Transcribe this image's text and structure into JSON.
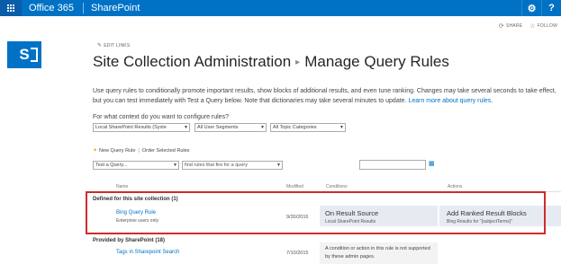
{
  "suite": {
    "brand": "Office 365",
    "product": "SharePoint",
    "settings_icon": "gear-icon",
    "help_icon": "question-icon",
    "accent": "#0072c6"
  },
  "page_actions": {
    "share": "SHARE",
    "follow": "FOLLOW"
  },
  "edit_links": "EDIT LINKS",
  "title": {
    "part1": "Site Collection Administration",
    "part2": "Manage Query Rules"
  },
  "description": {
    "text": "Use query rules to conditionally promote important results, show blocks of additional results, and even tune ranking. Changes may take several seconds to take effect, but you can test immediately with Test a Query below. Note that dictionaries may take several minutes to update.",
    "link": "Learn more about query rules."
  },
  "context": {
    "label": "For what context do you want to configure rules?",
    "source": "Local SharePoint Results (Syste",
    "segments": "All User Segments",
    "topics": "All Topic Categories"
  },
  "commands": {
    "new_rule": "New Query Rule",
    "divider": "|",
    "order": "Order Selected Rules"
  },
  "test": {
    "query": "Test a Query...",
    "find": "find rules that fire for a query"
  },
  "table": {
    "headers": {
      "name": "Name",
      "modified": "Modified",
      "conditions": "Conditions",
      "actions": "Actions"
    },
    "group1": {
      "title": "Defined for this site collection (1)",
      "rows": [
        {
          "name": "Bing Query Rule",
          "sub": "Enterprise users only",
          "modified": "9/30/2016",
          "condition_title": "On Result Source",
          "condition_sub": "Local SharePoint Results",
          "action_title": "Add Ranked Result Blocks",
          "action_sub": "Bing Results for \"{subjectTerms}\""
        }
      ]
    },
    "group2": {
      "title": "Provided by SharePoint (18)",
      "rows": [
        {
          "name": "Tags in Sharepoint Search",
          "modified": "7/10/2015",
          "condition_text": "A condition or action in this rule is not supported by these admin pages."
        }
      ]
    }
  }
}
